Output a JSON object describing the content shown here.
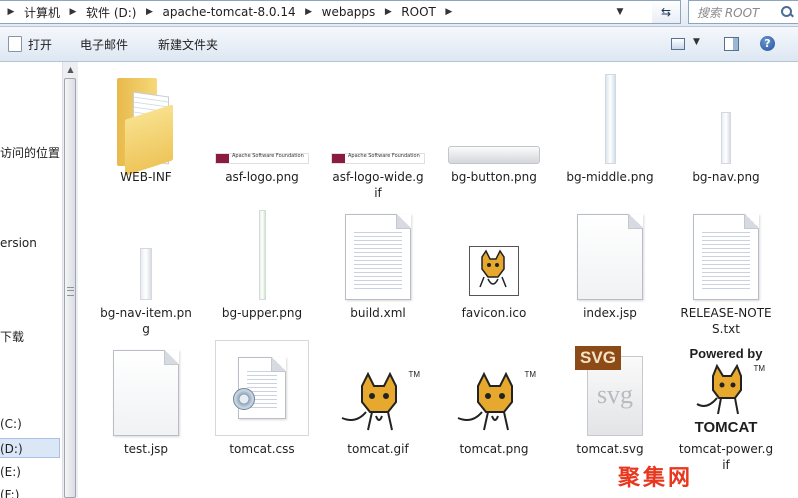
{
  "address": {
    "segments": [
      "计算机",
      "软件 (D:)",
      "apache-tomcat-8.0.14",
      "webapps",
      "ROOT"
    ],
    "search_placeholder": "搜索 ROOT"
  },
  "toolbar": {
    "open_label": "打开",
    "email_label": "电子邮件",
    "newfolder_label": "新建文件夹"
  },
  "nav": {
    "items": [
      "访问的位置",
      "ersion",
      "下载",
      "(C:)",
      "(D:)",
      "(E:)",
      "(F:)"
    ]
  },
  "files": [
    {
      "name": "WEB-INF",
      "lines": [
        "WEB-INF"
      ],
      "kind": "folder"
    },
    {
      "name": "asf-logo.png",
      "lines": [
        "asf-logo.png"
      ],
      "kind": "image"
    },
    {
      "name": "asf-logo-wide.gif",
      "lines": [
        "asf-logo-wide.g",
        "if"
      ],
      "kind": "image"
    },
    {
      "name": "bg-button.png",
      "lines": [
        "bg-button.png"
      ],
      "kind": "image"
    },
    {
      "name": "bg-middle.png",
      "lines": [
        "bg-middle.png"
      ],
      "kind": "image"
    },
    {
      "name": "bg-nav.png",
      "lines": [
        "bg-nav.png"
      ],
      "kind": "image"
    },
    {
      "name": "bg-nav-item.png",
      "lines": [
        "bg-nav-item.pn",
        "g"
      ],
      "kind": "image"
    },
    {
      "name": "bg-upper.png",
      "lines": [
        "bg-upper.png"
      ],
      "kind": "image"
    },
    {
      "name": "build.xml",
      "lines": [
        "build.xml"
      ],
      "kind": "document"
    },
    {
      "name": "favicon.ico",
      "lines": [
        "favicon.ico"
      ],
      "kind": "image"
    },
    {
      "name": "index.jsp",
      "lines": [
        "index.jsp"
      ],
      "kind": "document"
    },
    {
      "name": "RELEASE-NOTES.txt",
      "lines": [
        "RELEASE-NOTE",
        "S.txt"
      ],
      "kind": "document"
    },
    {
      "name": "test.jsp",
      "lines": [
        "test.jsp"
      ],
      "kind": "document",
      "selected": true
    },
    {
      "name": "tomcat.css",
      "lines": [
        "tomcat.css"
      ],
      "kind": "document"
    },
    {
      "name": "tomcat.gif",
      "lines": [
        "tomcat.gif"
      ],
      "kind": "image"
    },
    {
      "name": "tomcat.png",
      "lines": [
        "tomcat.png"
      ],
      "kind": "image"
    },
    {
      "name": "tomcat.svg",
      "lines": [
        "tomcat.svg"
      ],
      "kind": "image"
    },
    {
      "name": "tomcat-power.gif",
      "lines": [
        "tomcat-power.g",
        "if"
      ],
      "kind": "image"
    }
  ],
  "thumbs": {
    "asf_caption": "Apache Software Foundation",
    "svg_badge": "SVG",
    "svg_glyph": "svg",
    "powered_by": "Powered by",
    "tomcat_word": "TOMCAT",
    "tm": "TM"
  },
  "watermark": "聚集网",
  "colors": {
    "selection": "#cfe3fb",
    "highlight_frame": "#d84a4a",
    "watermark": "#e8371f"
  }
}
